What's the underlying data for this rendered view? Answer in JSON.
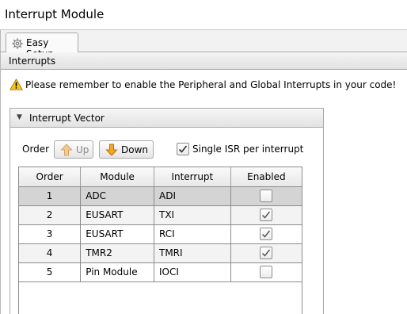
{
  "window": {
    "title": "Interrupt Module"
  },
  "tabs": [
    {
      "label": "Easy Setup",
      "icon": "gear-icon"
    }
  ],
  "section": {
    "title": "Interrupts"
  },
  "warning": {
    "icon": "warning-icon",
    "text": "Please remember to enable the Peripheral and Global Interrupts in your code!"
  },
  "panel": {
    "title": "Interrupt Vector",
    "order_label": "Order",
    "up_button": "Up",
    "down_button": "Down",
    "single_isr": {
      "label": "Single ISR per interrupt",
      "checked": true
    }
  },
  "table": {
    "headers": {
      "order": "Order",
      "module": "Module",
      "interrupt": "Interrupt",
      "enabled": "Enabled"
    },
    "rows": [
      {
        "order": "1",
        "module": "ADC",
        "interrupt": "ADI",
        "enabled": false,
        "selected": true
      },
      {
        "order": "2",
        "module": "EUSART",
        "interrupt": "TXI",
        "enabled": true,
        "selected": false
      },
      {
        "order": "3",
        "module": "EUSART",
        "interrupt": "RCI",
        "enabled": true,
        "selected": false
      },
      {
        "order": "4",
        "module": "TMR2",
        "interrupt": "TMRI",
        "enabled": true,
        "selected": false
      },
      {
        "order": "5",
        "module": "Pin Module",
        "interrupt": "IOCI",
        "enabled": false,
        "selected": false
      }
    ]
  },
  "colors": {
    "arrow_fill": "#f5a623",
    "arrow_stroke": "#b8720c",
    "warning_fill": "#f7c325",
    "selected_row": "#d4d4d4"
  }
}
